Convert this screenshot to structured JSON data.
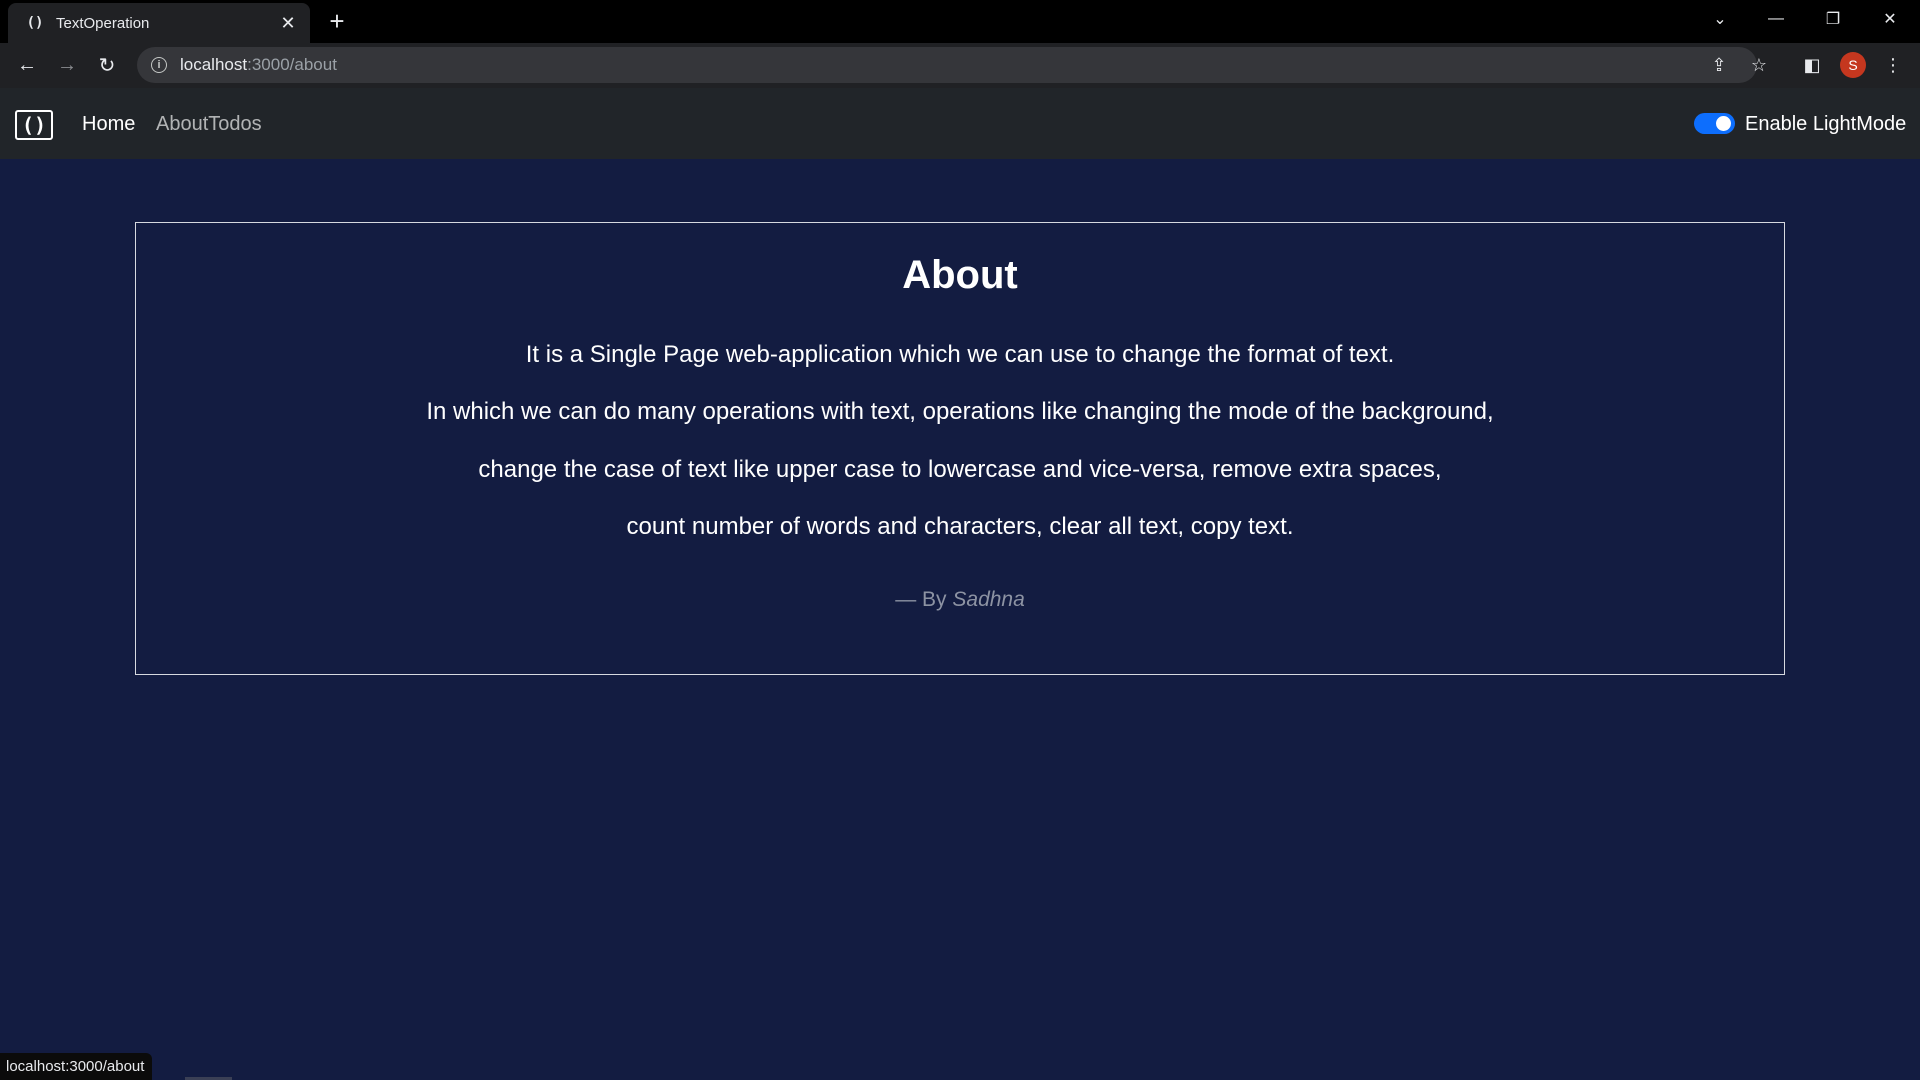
{
  "browser": {
    "tab_title": "TextOperation",
    "tab_favicon": "()",
    "url_host": "localhost",
    "url_path": ":3000/about",
    "profile_initial": "S",
    "status_url": "localhost:3000/about",
    "icons": {
      "back": "arrow-left-icon",
      "forward": "arrow-right-icon",
      "reload": "reload-icon",
      "share": "share-icon",
      "bookmark": "star-icon",
      "side_panel": "side-panel-icon",
      "menu": "kebab-menu-icon"
    }
  },
  "navbar": {
    "brand": "()",
    "links": [
      {
        "label": "Home",
        "active": true
      },
      {
        "label": "AboutTodos",
        "active": false
      }
    ],
    "toggle_label": "Enable LightMode",
    "toggle_on": true
  },
  "about": {
    "title": "About",
    "lines": [
      "It is a Single Page web-application which we can use to change the format of text.",
      "In which we can do many operations with text, operations like changing the mode of the background,",
      "change the case of text like upper case to lowercase and vice-versa, remove extra spaces,",
      "count number of words and characters, clear all text, copy text."
    ],
    "byline_prefix": "— By",
    "byline_author": "Sadhna"
  },
  "colors": {
    "page_bg": "#131c41",
    "navbar_bg": "#212529",
    "toggle_accent": "#0d6efd",
    "profile_bg": "#c5371f"
  }
}
